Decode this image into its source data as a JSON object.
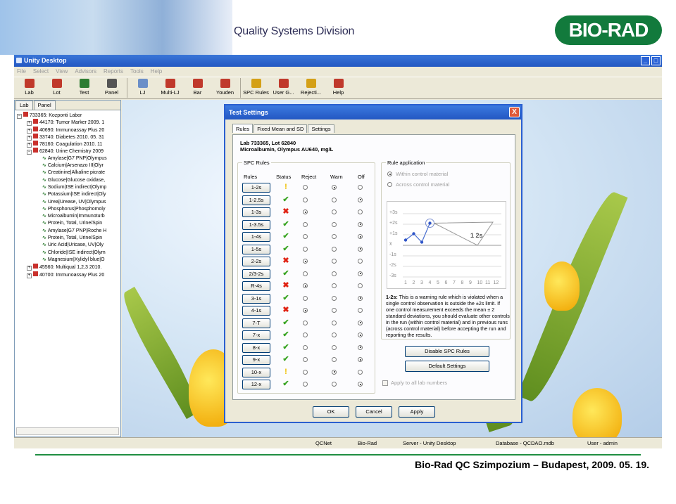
{
  "banner": {
    "division": "Quality Systems Division",
    "logo": "BIO-RAD"
  },
  "window": {
    "title": "Unity Desktop",
    "controls": [
      "_",
      "□"
    ],
    "menu": [
      "File",
      "Select",
      "View",
      "Advisors",
      "Reports",
      "Tools",
      "Help"
    ],
    "toolbar": [
      {
        "label": "Lab",
        "icon": "lab-icon",
        "color": "#c0392b"
      },
      {
        "label": "Lot",
        "icon": "lot-icon",
        "color": "#c0392b"
      },
      {
        "label": "Test",
        "icon": "test-icon",
        "color": "#2e7d32"
      },
      {
        "label": "Panel",
        "icon": "panel-icon",
        "color": "#555555"
      },
      {
        "label": "LJ",
        "icon": "lj-chart-icon",
        "color": "#6b8fc8"
      },
      {
        "label": "Multi-LJ",
        "icon": "multi-lj-icon",
        "color": "#c0392b"
      },
      {
        "label": "Bar",
        "icon": "bar-chart-icon",
        "color": "#c0392b"
      },
      {
        "label": "Youden",
        "icon": "youden-icon",
        "color": "#c0392b"
      },
      {
        "label": "SPC Rules",
        "icon": "spc-rules-icon",
        "color": "#d4a017"
      },
      {
        "label": "User G...",
        "icon": "user-group-icon",
        "color": "#c0392b"
      },
      {
        "label": "Rejecti...",
        "icon": "rejection-icon",
        "color": "#d4a017"
      },
      {
        "label": "Help",
        "icon": "help-icon",
        "color": "#c0392b"
      }
    ]
  },
  "left_panel": {
    "tabs": [
      "Lab",
      "Panel"
    ],
    "tree": [
      {
        "text": "733365: Kozponti Labor",
        "level": 0,
        "type": "root"
      },
      {
        "text": "44170: Tumor Marker 2009. 1",
        "level": 1,
        "type": "lot"
      },
      {
        "text": "40690: Immunoassay Plus 20",
        "level": 1,
        "type": "lot"
      },
      {
        "text": "33740: Diabetes 2010. 05. 31",
        "level": 1,
        "type": "lot"
      },
      {
        "text": "78160: Coagulation 2010. 11",
        "level": 1,
        "type": "lot"
      },
      {
        "text": "62840: Urine Chemistry 2009",
        "level": 1,
        "type": "lot-open"
      },
      {
        "text": "Amylase|G7 PNP|Olympus",
        "level": 2,
        "type": "test"
      },
      {
        "text": "Calcium|Arsenazo III|Olyr",
        "level": 2,
        "type": "test"
      },
      {
        "text": "Creatinine|Alkaline picrate",
        "level": 2,
        "type": "test"
      },
      {
        "text": "Glucose|Glucose oxidase,",
        "level": 2,
        "type": "test"
      },
      {
        "text": "Sodium|ISE indirect|Olymp",
        "level": 2,
        "type": "test"
      },
      {
        "text": "Potassium|ISE indirect|Oly",
        "level": 2,
        "type": "test"
      },
      {
        "text": "Urea|Urease, UV|Olympus",
        "level": 2,
        "type": "test"
      },
      {
        "text": "Phosphorus|Phosphomoly",
        "level": 2,
        "type": "test"
      },
      {
        "text": "Microalbumin|Immunoturb",
        "level": 2,
        "type": "test"
      },
      {
        "text": "Protein, Total, Urine/Spin",
        "level": 2,
        "type": "test"
      },
      {
        "text": "Amylase|G7 PNP|Roche H",
        "level": 2,
        "type": "test"
      },
      {
        "text": "Protein, Total, Urine/Spin",
        "level": 2,
        "type": "test"
      },
      {
        "text": "Uric Acid|Uricase, UV|Oly",
        "level": 2,
        "type": "test"
      },
      {
        "text": "Chloride|ISE indirect|Olym",
        "level": 2,
        "type": "test"
      },
      {
        "text": "Magnesium|Xylidyl blue|O",
        "level": 2,
        "type": "test"
      },
      {
        "text": "45560: Multiqual 1,2,3 2010.",
        "level": 1,
        "type": "lot"
      },
      {
        "text": "40700: Immunoassay Plus 20",
        "level": 1,
        "type": "lot"
      }
    ]
  },
  "dialog": {
    "title": "Test Settings",
    "close": "X",
    "tabs": [
      "Rules",
      "Fixed Mean and SD",
      "Settings"
    ],
    "lab_line": "Lab 733365, Lot 62840",
    "test_line": "Microalbumin, Olympus AU640, mg/L",
    "spc_group": "SPC Rules",
    "columns": [
      "Rules",
      "Status",
      "Reject",
      "Warn",
      "Off"
    ],
    "rules": [
      {
        "name": "1-2s",
        "status": "warning",
        "selected": "warn"
      },
      {
        "name": "1-2.5s",
        "status": "on",
        "selected": "off"
      },
      {
        "name": "1-3s",
        "status": "reject",
        "selected": "reject"
      },
      {
        "name": "1-3.5s",
        "status": "on",
        "selected": "off"
      },
      {
        "name": "1-4s",
        "status": "on",
        "selected": "off"
      },
      {
        "name": "1-5s",
        "status": "on",
        "selected": "off"
      },
      {
        "name": "2-2s",
        "status": "reject",
        "selected": "reject"
      },
      {
        "name": "2/3-2s",
        "status": "on",
        "selected": "off"
      },
      {
        "name": "R-4s",
        "status": "reject",
        "selected": "reject"
      },
      {
        "name": "3-1s",
        "status": "on",
        "selected": "off"
      },
      {
        "name": "4-1s",
        "status": "reject",
        "selected": "reject"
      },
      {
        "name": "7-T",
        "status": "on",
        "selected": "off"
      },
      {
        "name": "7-x",
        "status": "on",
        "selected": "off"
      },
      {
        "name": "8-x",
        "status": "on",
        "selected": "off"
      },
      {
        "name": "9-x",
        "status": "on",
        "selected": "off"
      },
      {
        "name": "10-x",
        "status": "warning",
        "selected": "warn"
      },
      {
        "name": "12-x",
        "status": "on",
        "selected": "off"
      }
    ],
    "status_glyphs": {
      "on": "✔",
      "reject": "✖",
      "warning": "!"
    },
    "rule_application": {
      "label": "Rule application",
      "options": [
        "Within control material",
        "Across control material"
      ],
      "selected": 0
    },
    "chart_data": {
      "type": "line",
      "title": "",
      "y_ticks": [
        "+3s",
        "+2s",
        "+1s",
        "x̄",
        "-1s",
        "-2s",
        "-3s"
      ],
      "x": [
        1,
        2,
        3,
        4,
        5,
        6,
        7,
        8,
        9,
        10,
        11,
        12
      ],
      "values": [
        0.5,
        1.1,
        0.3,
        2.1
      ],
      "rule_label": "1 2s"
    },
    "description_title": "1-2s:",
    "description": "This is a warning rule which is violated when a single control observation is outside the ±2s limit. If one control measurement exceeds the mean ± 2 standard deviations, you should evaluate other controls in the run (within control material) and in previous runs (across control material) before accepting the run and reporting the results.",
    "disable_btn": "Disable SPC Rules",
    "default_btn": "Default Settings",
    "apply_all": "Apply to all lab numbers",
    "ok": "OK",
    "cancel": "Cancel",
    "apply": "Apply"
  },
  "statusbar": {
    "items": [
      "QCNet",
      "Bio-Rad",
      "Server - Unity Desktop",
      "Database - QCDAO.mdb",
      "User - admin"
    ]
  },
  "footer": {
    "text": "Bio-Rad QC Szimpozium – Budapest, 2009. 05. 19."
  }
}
